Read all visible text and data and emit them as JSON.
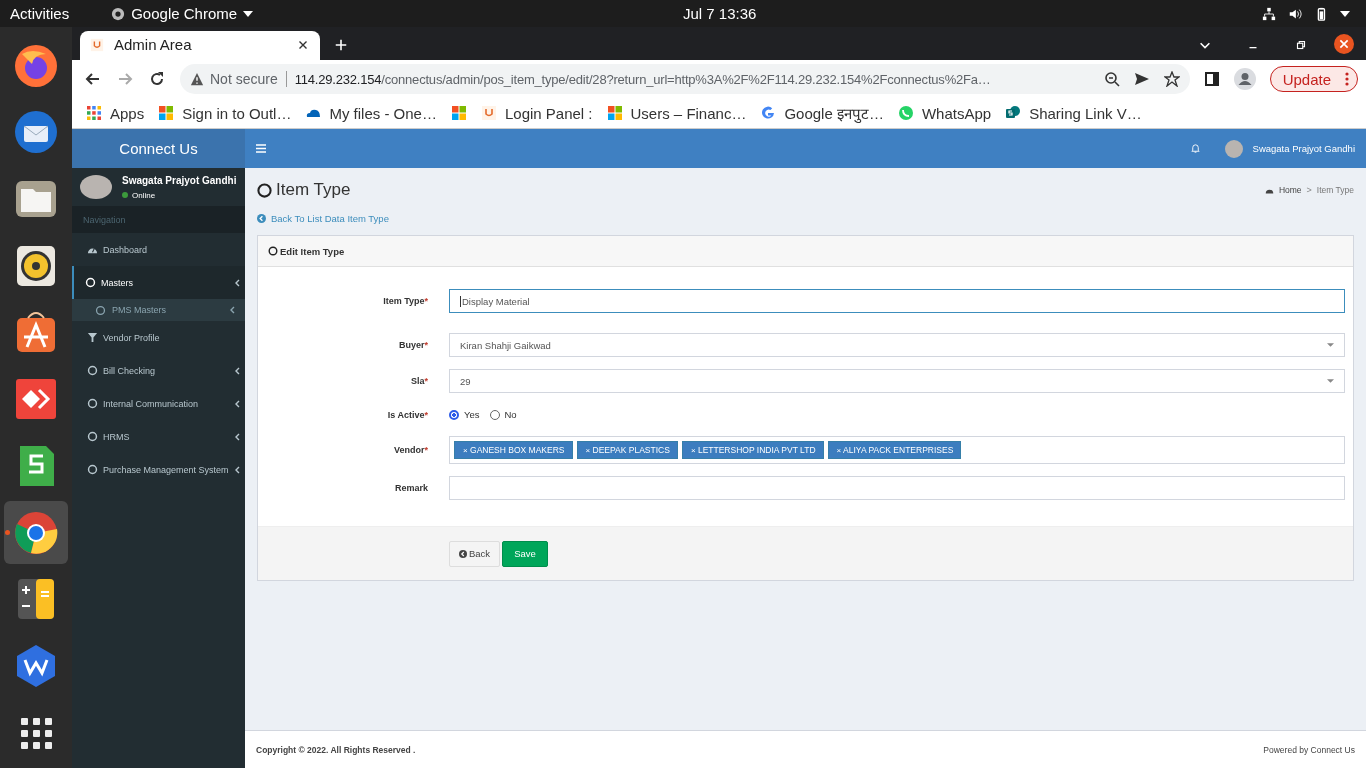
{
  "top_bar": {
    "activities": "Activities",
    "app_menu": "Google Chrome",
    "clock": "Jul 7  13:36"
  },
  "dock": [
    {
      "kind": "firefox",
      "running": false
    },
    {
      "kind": "thunderbird",
      "running": false
    },
    {
      "kind": "files",
      "running": false
    },
    {
      "kind": "speaker",
      "running": false
    },
    {
      "kind": "store",
      "running": false
    },
    {
      "kind": "anydesk",
      "running": false
    },
    {
      "kind": "sheet",
      "running": false
    },
    {
      "kind": "chrome",
      "running": true
    },
    {
      "kind": "calculator",
      "running": false
    },
    {
      "kind": "wps",
      "running": false
    },
    {
      "kind": "grid",
      "running": false
    }
  ],
  "browser": {
    "tabs": [
      {
        "title": "Admin Area",
        "selected": true
      }
    ],
    "address": {
      "security": "Not secure",
      "host": "114.29.232.154",
      "path": "/connectus/admin/pos_item_type/edit/28?return_url=http%3A%2F%2F114.29.232.154%2Fconnectus%2Fa…"
    },
    "update_button": "Update",
    "bookmarks": [
      {
        "kind": "apps",
        "label": "Apps"
      },
      {
        "kind": "microsoft",
        "label": "Sign in to Outl…"
      },
      {
        "kind": "onedrive",
        "label": "My files - One…"
      },
      {
        "kind": "microsoft"
      },
      {
        "kind": "connectus",
        "label": "Login Panel :"
      },
      {
        "kind": "microsoft",
        "label": "Users – Financ…"
      },
      {
        "kind": "google",
        "label": "Google इनपुट…"
      },
      {
        "kind": "whatsapp",
        "label": "WhatsApp"
      },
      {
        "kind": "sharepoint",
        "label": "Sharing Link V…"
      }
    ]
  },
  "app": {
    "brand": "Connect Us",
    "user": {
      "name": "Swagata Prajyot Gandhi",
      "status": "Online"
    },
    "nav_header": "Navigation",
    "nav": [
      {
        "label": "Dashboard",
        "kind": "dashboard",
        "submenu": false,
        "selected": false
      },
      {
        "label": "Masters",
        "kind": "circle",
        "submenu": true,
        "selected": true,
        "children": [
          {
            "label": "PMS Masters",
            "kind": "circle",
            "submenu": true,
            "selected": false
          }
        ]
      },
      {
        "label": "Vendor Profile",
        "kind": "filter",
        "submenu": false,
        "selected": false
      },
      {
        "label": "Bill Checking",
        "kind": "circle",
        "submenu": true,
        "selected": false
      },
      {
        "label": "Internal Communication",
        "kind": "circle",
        "submenu": true,
        "selected": false
      },
      {
        "label": "HRMS",
        "kind": "circle",
        "submenu": true,
        "selected": false
      },
      {
        "label": "Purchase Management System",
        "kind": "circle",
        "submenu": true,
        "selected": false
      }
    ],
    "header_user": "Swagata Prajyot Gandhi",
    "page_title": "Item Type",
    "breadcrumb": {
      "separator": ">",
      "items": [
        {
          "kind": "home",
          "label": "Home"
        },
        {
          "kind": "current",
          "label": "Item Type"
        }
      ]
    },
    "back_link": "Back To List Data Item Type",
    "panel_title": "Edit Item Type",
    "fields": [
      {
        "kind": "text",
        "label": "Item Type",
        "mark": "*",
        "value": "Display Material",
        "focused": true
      },
      {
        "kind": "select",
        "label": "Buyer",
        "mark": "*",
        "value": "Kiran Shahji Gaikwad"
      },
      {
        "kind": "select",
        "label": "Sla",
        "mark": "*",
        "value": "29"
      },
      {
        "kind": "radio",
        "label": "Is Active",
        "mark": "*",
        "options": [
          {
            "label": "Yes",
            "selected": true
          },
          {
            "label": "No",
            "selected": false
          }
        ]
      },
      {
        "kind": "tags",
        "label": "Vendor",
        "mark": "*",
        "tags": [
          {
            "remove": "×",
            "label": "GANESH BOX MAKERS"
          },
          {
            "remove": "×",
            "label": "DEEPAK PLASTICS"
          },
          {
            "remove": "×",
            "label": "LETTERSHOP INDIA PVT LTD"
          },
          {
            "remove": "×",
            "label": "ALIYA PACK ENTERPRISES"
          }
        ]
      },
      {
        "kind": "text",
        "label": "Remark",
        "focused": false
      }
    ],
    "buttons": [
      {
        "kind": "back",
        "label": "Back"
      },
      {
        "kind": "save",
        "label": "Save"
      }
    ],
    "footer": {
      "copyright": "Copyright © 2022. All Rights Reserved .",
      "powered": "Powered by Connect Us"
    }
  }
}
